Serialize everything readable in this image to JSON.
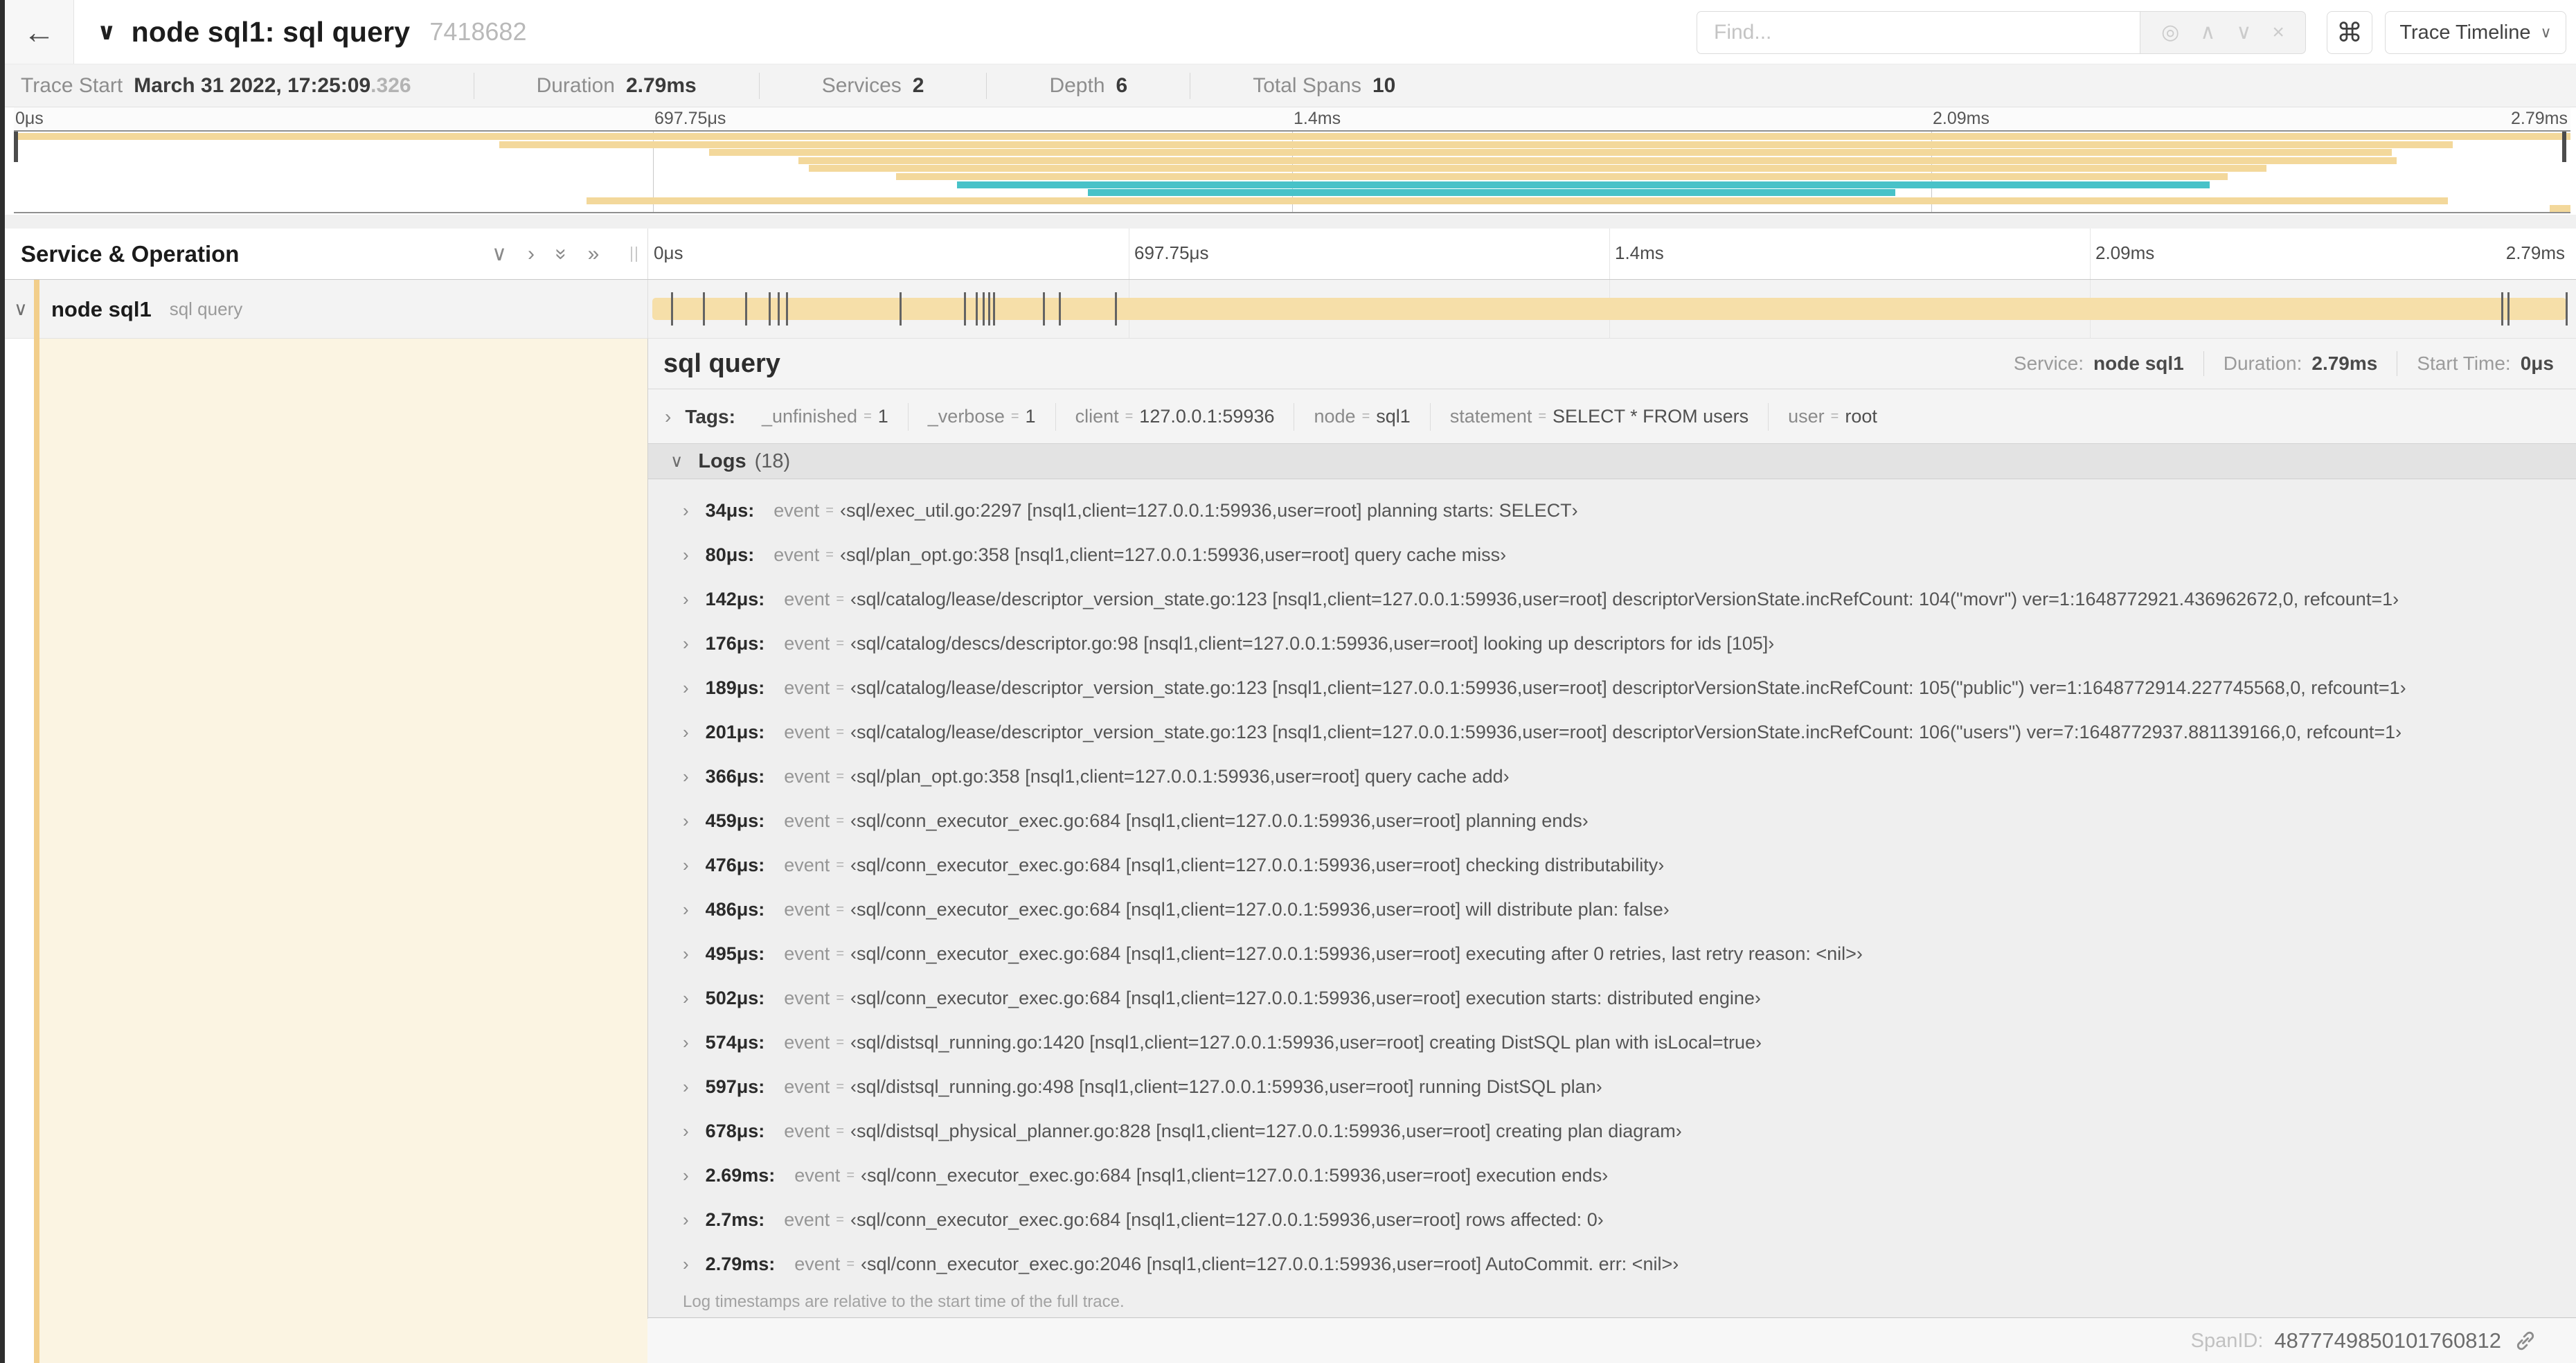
{
  "header": {
    "back_icon": "←",
    "collapse_icon": "∨",
    "title": "node sql1: sql query",
    "trace_id": "7418682",
    "find_placeholder": "Find...",
    "find_controls": {
      "target_icon": "◎",
      "prev_icon": "∧",
      "next_icon": "∨",
      "clear_icon": "×"
    },
    "shortcut_icon": "⌘",
    "view_selector_label": "Trace Timeline",
    "view_selector_caret": "∨"
  },
  "summary": {
    "items": [
      {
        "label": "Trace Start",
        "value": "March 31 2022, 17:25:09",
        "suffix": ".326"
      },
      {
        "label": "Duration",
        "value": "2.79ms",
        "suffix": ""
      },
      {
        "label": "Services",
        "value": "2",
        "suffix": ""
      },
      {
        "label": "Depth",
        "value": "6",
        "suffix": ""
      },
      {
        "label": "Total Spans",
        "value": "10",
        "suffix": ""
      }
    ]
  },
  "minimap": {
    "ticks": [
      {
        "label": "0μs",
        "pos": 0
      },
      {
        "label": "697.75μs",
        "pos": 0.25
      },
      {
        "label": "1.4ms",
        "pos": 0.5
      },
      {
        "label": "2.09ms",
        "pos": 0.75
      },
      {
        "label": "2.79ms",
        "pos": 1
      }
    ],
    "spans": [
      {
        "start": 0,
        "end": 1,
        "color": "tan"
      },
      {
        "start": 0.19,
        "end": 0.954,
        "color": "tan"
      },
      {
        "start": 0.272,
        "end": 0.93,
        "color": "tan"
      },
      {
        "start": 0.307,
        "end": 0.932,
        "color": "tan"
      },
      {
        "start": 0.311,
        "end": 0.881,
        "color": "tan"
      },
      {
        "start": 0.345,
        "end": 0.866,
        "color": "tan"
      },
      {
        "start": 0.369,
        "end": 0.859,
        "color": "teal"
      },
      {
        "start": 0.42,
        "end": 0.736,
        "color": "teal"
      },
      {
        "start": 0.224,
        "end": 0.952,
        "color": "tan"
      },
      {
        "start": 0.992,
        "end": 1,
        "color": "tan"
      }
    ]
  },
  "timeline": {
    "left_header": "Service & Operation",
    "collapse_icons": {
      "one_down": "∨",
      "one_right": "›",
      "all_down": "»",
      "all_right": "»"
    },
    "row": {
      "expander": "∨",
      "service": "node sql1",
      "operation": "sql query"
    },
    "log_marks": [
      0.0122,
      0.0287,
      0.0509,
      0.0631,
      0.0677,
      0.072,
      0.1312,
      0.1645,
      0.1706,
      0.1742,
      0.1774,
      0.1799,
      0.2057,
      0.214,
      0.243,
      0.9642,
      0.9677,
      0.998
    ]
  },
  "detail": {
    "title": "sql query",
    "info": [
      {
        "label": "Service:",
        "value": "node sql1"
      },
      {
        "label": "Duration:",
        "value": "2.79ms"
      },
      {
        "label": "Start Time:",
        "value": "0μs"
      }
    ],
    "eq_sign": "=",
    "tags": {
      "expander": "›",
      "label": "Tags:",
      "items": [
        {
          "key": "_unfinished",
          "value": "1"
        },
        {
          "key": "_verbose",
          "value": "1"
        },
        {
          "key": "client",
          "value": "127.0.0.1:59936"
        },
        {
          "key": "node",
          "value": "sql1"
        },
        {
          "key": "statement",
          "value": "SELECT * FROM users"
        },
        {
          "key": "user",
          "value": "root"
        }
      ]
    },
    "logs": {
      "expander": "∨",
      "label": "Logs",
      "count": "(18)",
      "rows": [
        {
          "time": "34μs:",
          "key": "event",
          "value": "‹sql/exec_util.go:2297 [nsql1,client=127.0.0.1:59936,user=root] planning starts: SELECT›"
        },
        {
          "time": "80μs:",
          "key": "event",
          "value": "‹sql/plan_opt.go:358 [nsql1,client=127.0.0.1:59936,user=root] query cache miss›"
        },
        {
          "time": "142μs:",
          "key": "event",
          "value": "‹sql/catalog/lease/descriptor_version_state.go:123 [nsql1,client=127.0.0.1:59936,user=root] descriptorVersionState.incRefCount: 104(\"movr\") ver=1:1648772921.436962672,0, refcount=1›"
        },
        {
          "time": "176μs:",
          "key": "event",
          "value": "‹sql/catalog/descs/descriptor.go:98 [nsql1,client=127.0.0.1:59936,user=root] looking up descriptors for ids [105]›"
        },
        {
          "time": "189μs:",
          "key": "event",
          "value": "‹sql/catalog/lease/descriptor_version_state.go:123 [nsql1,client=127.0.0.1:59936,user=root] descriptorVersionState.incRefCount: 105(\"public\") ver=1:1648772914.227745568,0, refcount=1›"
        },
        {
          "time": "201μs:",
          "key": "event",
          "value": "‹sql/catalog/lease/descriptor_version_state.go:123 [nsql1,client=127.0.0.1:59936,user=root] descriptorVersionState.incRefCount: 106(\"users\") ver=7:1648772937.881139166,0, refcount=1›"
        },
        {
          "time": "366μs:",
          "key": "event",
          "value": "‹sql/plan_opt.go:358 [nsql1,client=127.0.0.1:59936,user=root] query cache add›"
        },
        {
          "time": "459μs:",
          "key": "event",
          "value": "‹sql/conn_executor_exec.go:684 [nsql1,client=127.0.0.1:59936,user=root] planning ends›"
        },
        {
          "time": "476μs:",
          "key": "event",
          "value": "‹sql/conn_executor_exec.go:684 [nsql1,client=127.0.0.1:59936,user=root] checking distributability›"
        },
        {
          "time": "486μs:",
          "key": "event",
          "value": "‹sql/conn_executor_exec.go:684 [nsql1,client=127.0.0.1:59936,user=root] will distribute plan: false›"
        },
        {
          "time": "495μs:",
          "key": "event",
          "value": "‹sql/conn_executor_exec.go:684 [nsql1,client=127.0.0.1:59936,user=root] executing after 0 retries, last retry reason: <nil>›"
        },
        {
          "time": "502μs:",
          "key": "event",
          "value": "‹sql/conn_executor_exec.go:684 [nsql1,client=127.0.0.1:59936,user=root] execution starts: distributed engine›"
        },
        {
          "time": "574μs:",
          "key": "event",
          "value": "‹sql/distsql_running.go:1420 [nsql1,client=127.0.0.1:59936,user=root] creating DistSQL plan with isLocal=true›"
        },
        {
          "time": "597μs:",
          "key": "event",
          "value": "‹sql/distsql_running.go:498 [nsql1,client=127.0.0.1:59936,user=root] running DistSQL plan›"
        },
        {
          "time": "678μs:",
          "key": "event",
          "value": "‹sql/distsql_physical_planner.go:828 [nsql1,client=127.0.0.1:59936,user=root] creating plan diagram›"
        },
        {
          "time": "2.69ms:",
          "key": "event",
          "value": "‹sql/conn_executor_exec.go:684 [nsql1,client=127.0.0.1:59936,user=root] execution ends›"
        },
        {
          "time": "2.7ms:",
          "key": "event",
          "value": "‹sql/conn_executor_exec.go:684 [nsql1,client=127.0.0.1:59936,user=root] rows affected: 0›"
        },
        {
          "time": "2.79ms:",
          "key": "event",
          "value": "‹sql/conn_executor_exec.go:2046 [nsql1,client=127.0.0.1:59936,user=root] AutoCommit. err: <nil>›"
        }
      ]
    },
    "footer_note": "Log timestamps are relative to the start time of the full trace.",
    "span_id_label": "SpanID:",
    "span_id": "4877749850101760812"
  },
  "colors": {
    "tan": "#F3D89B",
    "teal": "#48C2C8",
    "accent_stripe": "#F2CE8A",
    "bar": "#F6DFA9",
    "cream": "#FBF4E2"
  }
}
